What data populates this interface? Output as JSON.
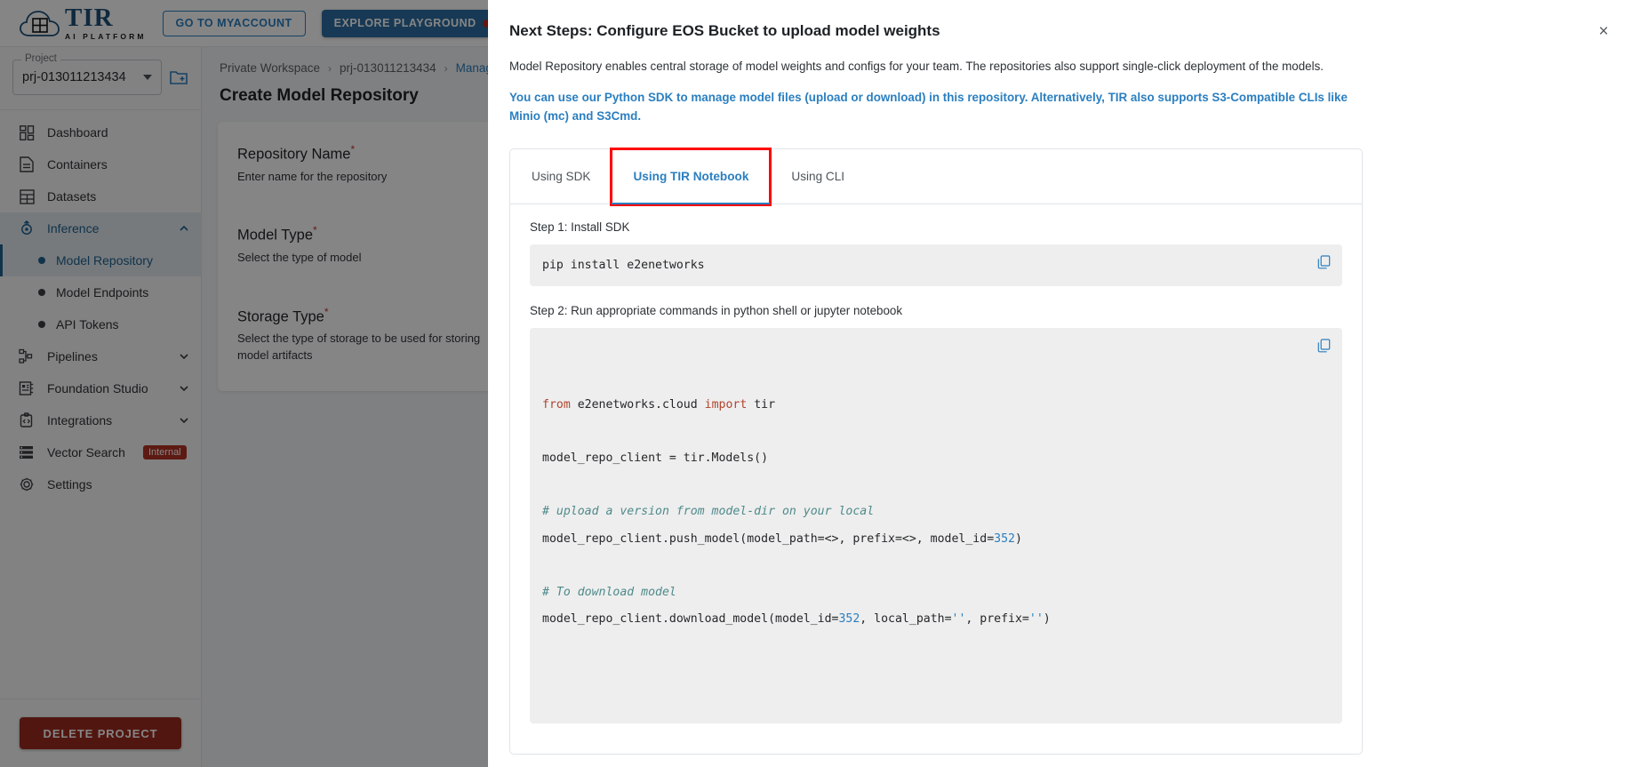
{
  "topbar": {
    "logo_name": "TIR",
    "logo_sub": "AI PLATFORM",
    "myaccount_label": "GO TO MYACCOUNT",
    "playground_label": "EXPLORE PLAYGROUND"
  },
  "sidebar": {
    "project_label": "Project",
    "project_value": "prj-013011213434",
    "items": [
      {
        "label": "Dashboard",
        "icon": "dashboard-icon",
        "type": "top"
      },
      {
        "label": "Containers",
        "icon": "document-icon",
        "type": "top"
      },
      {
        "label": "Datasets",
        "icon": "grid-icon",
        "type": "top"
      },
      {
        "label": "Inference",
        "icon": "inference-icon",
        "type": "top",
        "expanded": true,
        "active": true
      },
      {
        "label": "Model Repository",
        "icon": "bullet-icon",
        "type": "sub",
        "current": true
      },
      {
        "label": "Model Endpoints",
        "icon": "bullet-icon",
        "type": "sub"
      },
      {
        "label": "API Tokens",
        "icon": "bullet-icon",
        "type": "sub"
      },
      {
        "label": "Pipelines",
        "icon": "pipeline-icon",
        "type": "top",
        "collapsed": true
      },
      {
        "label": "Foundation Studio",
        "icon": "studio-icon",
        "type": "top",
        "collapsed": true
      },
      {
        "label": "Integrations",
        "icon": "integrations-icon",
        "type": "top",
        "collapsed": true
      },
      {
        "label": "Vector Search",
        "icon": "list-icon",
        "type": "top",
        "badge": "Internal"
      },
      {
        "label": "Settings",
        "icon": "gear-icon",
        "type": "top"
      }
    ],
    "delete_project_label": "DELETE PROJECT"
  },
  "breadcrumb": {
    "workspace": "Private Workspace",
    "project": "prj-013011213434",
    "section": "Manage Mo"
  },
  "page": {
    "title": "Create Model Repository",
    "fields": [
      {
        "title": "Repository Name",
        "required": "*",
        "desc": "Enter name for the repository"
      },
      {
        "title": "Model Type",
        "required": "*",
        "desc": "Select the type of model"
      },
      {
        "title": "Storage Type",
        "required": "*",
        "desc": "Select the type of storage to be used for storing model artifacts"
      }
    ]
  },
  "modal": {
    "title": "Next Steps: Configure EOS Bucket to upload model weights",
    "close_label": "×",
    "description": "Model Repository enables central storage of model weights and configs for your team. The repositories also support single-click deployment of the models.",
    "note": "You can use our Python SDK to manage model files (upload or download) in this repository. Alternatively, TIR also supports S3-Compatible CLIs like Minio (mc) and S3Cmd.",
    "tabs": [
      {
        "label": "Using SDK",
        "active": false
      },
      {
        "label": "Using TIR Notebook",
        "active": true
      },
      {
        "label": "Using CLI",
        "active": false
      }
    ],
    "step1_label": "Step 1: Install SDK",
    "step1_code": "pip install e2enetworks",
    "step2_label": "Step 2: Run appropriate commands in python shell or jupyter notebook",
    "step2_code_lines": [
      {
        "tokens": [
          {
            "t": "from",
            "c": "kw"
          },
          {
            "t": " e2enetworks.cloud ",
            "c": ""
          },
          {
            "t": "import",
            "c": "kw"
          },
          {
            "t": " tir",
            "c": ""
          }
        ]
      },
      {
        "tokens": [
          {
            "t": "",
            "c": ""
          }
        ]
      },
      {
        "tokens": [
          {
            "t": "model_repo_client = tir.Models()",
            "c": ""
          }
        ]
      },
      {
        "tokens": [
          {
            "t": "",
            "c": ""
          }
        ]
      },
      {
        "tokens": [
          {
            "t": "# upload a version from model-dir on your local",
            "c": "cm"
          }
        ]
      },
      {
        "tokens": [
          {
            "t": "model_repo_client.push_model(model_path=<>, prefix=<>, model_id=",
            "c": ""
          },
          {
            "t": "352",
            "c": "num"
          },
          {
            "t": ")",
            "c": ""
          }
        ]
      },
      {
        "tokens": [
          {
            "t": "",
            "c": ""
          }
        ]
      },
      {
        "tokens": [
          {
            "t": "# To download model",
            "c": "cm"
          }
        ]
      },
      {
        "tokens": [
          {
            "t": "model_repo_client.download_model(model_id=",
            "c": ""
          },
          {
            "t": "352",
            "c": "num"
          },
          {
            "t": ", local_path=",
            "c": ""
          },
          {
            "t": "''",
            "c": "str"
          },
          {
            "t": ", prefix=",
            "c": ""
          },
          {
            "t": "''",
            "c": "str"
          },
          {
            "t": ")",
            "c": ""
          }
        ]
      }
    ],
    "copy_icon_label": "copy-icon"
  },
  "colors": {
    "accent": "#2b7fc0",
    "primary": "#2d6ea3",
    "danger": "#9e2b20",
    "highlight": "#ff0000"
  }
}
